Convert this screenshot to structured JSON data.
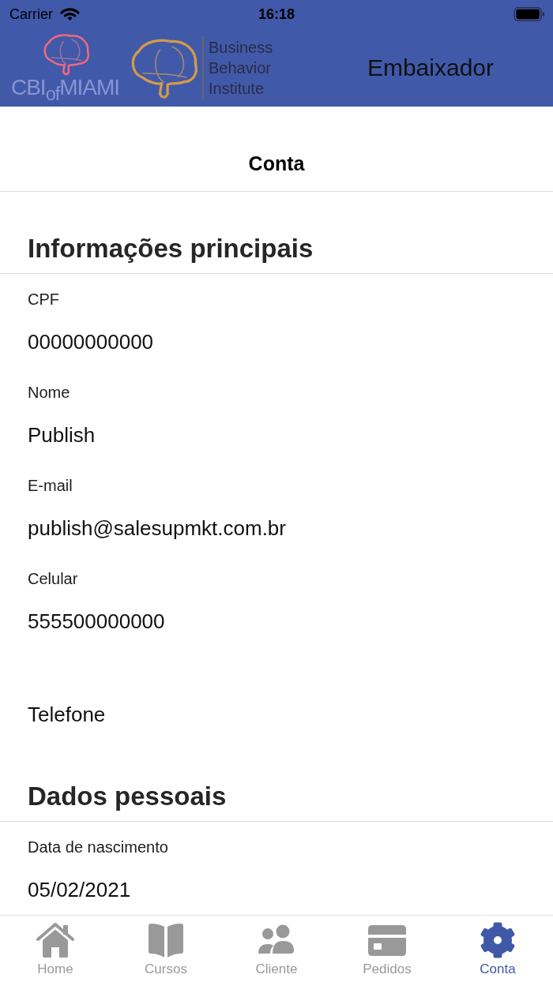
{
  "status_bar": {
    "carrier": "Carrier",
    "time": "16:18"
  },
  "header": {
    "small_logo_text": "CBI$_{of}$MIAMI",
    "logo_text": "Business Behavior Institute",
    "role": "Embaixador"
  },
  "page_title": "Conta",
  "sections": [
    {
      "title": "Informações principais",
      "fields": [
        {
          "label": "CPF",
          "value": "00000000000"
        },
        {
          "label": "Nome",
          "value": "Publish"
        },
        {
          "label": "E-mail",
          "value": "publish@salesupmkt.com.br"
        },
        {
          "label": "Celular",
          "value": "555500000000"
        },
        {
          "label": "Telefone"
        }
      ]
    },
    {
      "title": "Dados pessoais",
      "fields": [
        {
          "label": "Data de nascimento",
          "value": "05/02/2021"
        }
      ]
    }
  ],
  "tabs": [
    {
      "label": "Home",
      "selected": false
    },
    {
      "label": "Cursos",
      "selected": false
    },
    {
      "label": "Cliente",
      "selected": false
    },
    {
      "label": "Pedidos",
      "selected": false
    },
    {
      "label": "Conta",
      "selected": true
    }
  ]
}
